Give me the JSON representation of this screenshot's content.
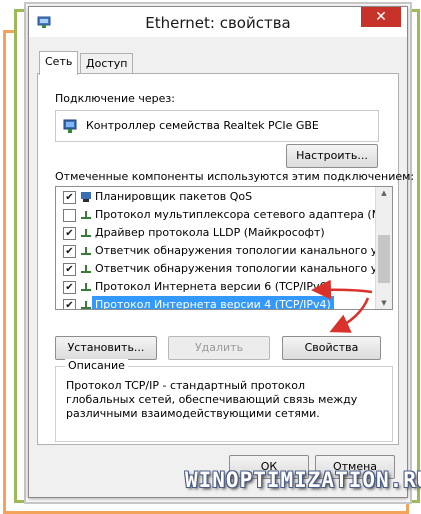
{
  "window": {
    "title": "Ethernet: свойства",
    "close_label": "✕"
  },
  "tabs": [
    {
      "label": "Сеть",
      "active": true
    },
    {
      "label": "Доступ",
      "active": false
    }
  ],
  "connect_via": {
    "label": "Подключение через:",
    "adapter": "Контроллер семейства Realtek PCIe GBE",
    "configure_button": "Настроить..."
  },
  "components": {
    "label": "Отмеченные компоненты используются этим подключением:",
    "items": [
      {
        "label": "Планировщик пакетов QoS",
        "checked": true,
        "icon": "network-icon"
      },
      {
        "label": "Протокол мультиплексора сетевого адаптера (Май",
        "checked": false,
        "icon": "protocol-icon"
      },
      {
        "label": "Драйвер протокола LLDP (Майкрософт)",
        "checked": true,
        "icon": "protocol-icon"
      },
      {
        "label": "Ответчик обнаружения топологии канального уров",
        "checked": true,
        "icon": "protocol-icon"
      },
      {
        "label": "Ответчик обнаружения топологии канального уров",
        "checked": true,
        "icon": "protocol-icon"
      },
      {
        "label": "Протокол Интернета версии 6 (TCP/IPv6)",
        "checked": true,
        "icon": "protocol-icon"
      },
      {
        "label": "Протокол Интернета версии 4 (TCP/IPv4)",
        "checked": true,
        "icon": "protocol-icon",
        "selected": true
      }
    ]
  },
  "actions": {
    "install": "Установить...",
    "remove": "Удалить",
    "properties": "Свойства"
  },
  "description": {
    "legend": "Описание",
    "text": "Протокол TCP/IP - стандартный протокол глобальных сетей, обеспечивающий связь между различными взаимодействующими сетями."
  },
  "footer": {
    "ok": "ОК",
    "cancel": "Отмена"
  },
  "watermark": "WINOPTIMIZATION.RU",
  "colors": {
    "accent_red": "#d9312b",
    "selection": "#3399ff",
    "close_button": "#c7322b"
  }
}
